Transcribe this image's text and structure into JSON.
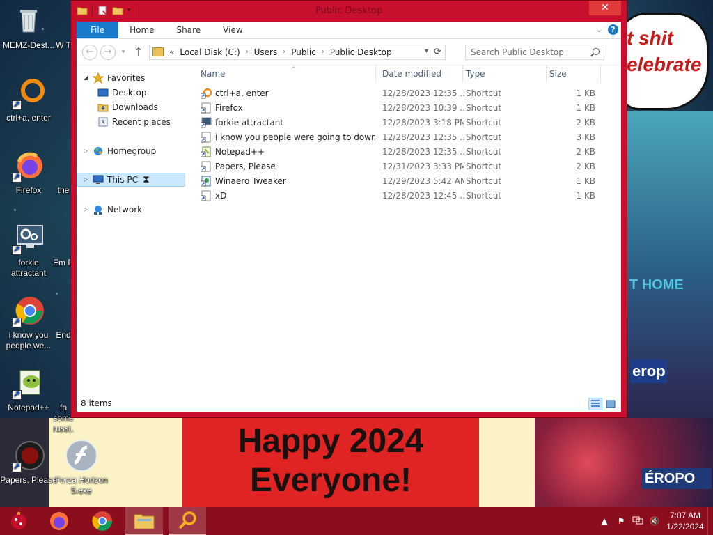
{
  "desktop": {
    "icons": [
      {
        "label": "MEMZ-Dest..."
      },
      {
        "label": "ctrl+a, enter"
      },
      {
        "label": "Firefox"
      },
      {
        "label": "forkie attractant"
      },
      {
        "label": "i know you people we..."
      },
      {
        "label": "Notepad++"
      },
      {
        "label": "Papers, Please"
      },
      {
        "label": "Forza Horizon 5.exe"
      },
      {
        "label": "the"
      },
      {
        "label": "Em D"
      },
      {
        "label": "End"
      },
      {
        "label": "fo some russi..."
      },
      {
        "label": "W T"
      }
    ],
    "bubble_text_1": "t shit",
    "bubble_text_2": "elebrate",
    "banner_line_1": "Happy 2024",
    "banner_line_2": "Everyone!",
    "sign_1": "T HOME",
    "sign_2": "erop",
    "sign_3": "ÉROPO"
  },
  "window": {
    "title": "Public Desktop",
    "close_label": "✕",
    "ribbon": {
      "tabs": [
        "File",
        "Home",
        "Share",
        "View"
      ],
      "help": "?"
    },
    "address": {
      "prefix": "«",
      "crumbs": [
        "Local Disk (C:)",
        "Users",
        "Public",
        "Public Desktop"
      ]
    },
    "search_placeholder": "Search Public Desktop",
    "nav_pane": {
      "favorites": "Favorites",
      "desktop": "Desktop",
      "downloads": "Downloads",
      "recent": "Recent places",
      "homegroup": "Homegroup",
      "this_pc": "This PC",
      "network": "Network"
    },
    "columns": {
      "name": "Name",
      "date": "Date modified",
      "type": "Type",
      "size": "Size"
    },
    "files": [
      {
        "name": "ctrl+a, enter",
        "date": "12/28/2023 12:35 ...",
        "type": "Shortcut",
        "size": "1 KB"
      },
      {
        "name": "Firefox",
        "date": "12/28/2023 10:39 ...",
        "type": "Shortcut",
        "size": "1 KB"
      },
      {
        "name": "forkie attractant",
        "date": "12/28/2023 3:18 PM",
        "type": "Shortcut",
        "size": "2 KB"
      },
      {
        "name": "i know you people were going to downlo...",
        "date": "12/28/2023 12:35 ...",
        "type": "Shortcut",
        "size": "3 KB"
      },
      {
        "name": "Notepad++",
        "date": "12/28/2023 12:35 ...",
        "type": "Shortcut",
        "size": "2 KB"
      },
      {
        "name": "Papers, Please",
        "date": "12/31/2023 3:33 PM",
        "type": "Shortcut",
        "size": "2 KB"
      },
      {
        "name": "Winaero Tweaker",
        "date": "12/29/2023 5:42 AM",
        "type": "Shortcut",
        "size": "1 KB"
      },
      {
        "name": "xD",
        "date": "12/28/2023 12:45 ...",
        "type": "Shortcut",
        "size": "1 KB"
      }
    ],
    "status": "8 items"
  },
  "taskbar": {
    "time": "7:07 AM",
    "date": "1/22/2024"
  },
  "colors": {
    "window_frame": "#c8102e",
    "taskbar": "#8a0e1d",
    "accent": "#1979ca"
  }
}
